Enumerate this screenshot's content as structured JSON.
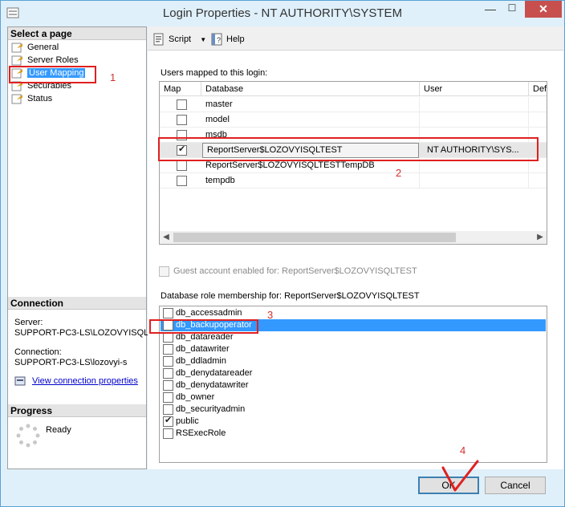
{
  "window": {
    "title": "Login Properties - NT AUTHORITY\\SYSTEM",
    "close_icon": "✕",
    "minimize_icon": "—",
    "maximize_icon": "☐"
  },
  "left": {
    "select_page_header": "Select a page",
    "pages": [
      {
        "label": "General"
      },
      {
        "label": "Server Roles"
      },
      {
        "label": "User Mapping"
      },
      {
        "label": "Securables"
      },
      {
        "label": "Status"
      }
    ],
    "connection_header": "Connection",
    "server_label": "Server:",
    "server_value": "SUPPORT-PC3-LS\\LOZOVYISQL",
    "connection_label": "Connection:",
    "connection_value": "SUPPORT-PC3-LS\\lozovyi-s",
    "view_link": "View connection properties",
    "progress_header": "Progress",
    "progress_status": "Ready"
  },
  "toolbar": {
    "script_label": "Script",
    "help_label": "Help"
  },
  "mapping": {
    "group_label": "Users mapped to this login:",
    "columns": [
      "Map",
      "Database",
      "User",
      "Defa"
    ],
    "rows": [
      {
        "map": false,
        "database": "master",
        "user": ""
      },
      {
        "map": false,
        "database": "model",
        "user": ""
      },
      {
        "map": false,
        "database": "msdb",
        "user": ""
      },
      {
        "map": true,
        "database": "ReportServer$LOZOVYISQLTEST",
        "user": "NT AUTHORITY\\SYS..."
      },
      {
        "map": false,
        "database": "ReportServer$LOZOVYISQLTESTTempDB",
        "user": ""
      },
      {
        "map": false,
        "database": "tempdb",
        "user": ""
      }
    ]
  },
  "guest_label": "Guest account enabled for: ReportServer$LOZOVYISQLTEST",
  "roles": {
    "group_label": "Database role membership for: ReportServer$LOZOVYISQLTEST",
    "items": [
      {
        "label": "db_accessadmin",
        "checked": false
      },
      {
        "label": "db_backupoperator",
        "checked": false
      },
      {
        "label": "db_datareader",
        "checked": false
      },
      {
        "label": "db_datawriter",
        "checked": false
      },
      {
        "label": "db_ddladmin",
        "checked": false
      },
      {
        "label": "db_denydatareader",
        "checked": false
      },
      {
        "label": "db_denydatawriter",
        "checked": false
      },
      {
        "label": "db_owner",
        "checked": false
      },
      {
        "label": "db_securityadmin",
        "checked": false
      },
      {
        "label": "public",
        "checked": true
      },
      {
        "label": "RSExecRole",
        "checked": false
      }
    ]
  },
  "buttons": {
    "ok": "OK",
    "cancel": "Cancel"
  },
  "annotations": {
    "n1": "1",
    "n2": "2",
    "n3": "3",
    "n4": "4",
    "accent": "#e02020"
  }
}
